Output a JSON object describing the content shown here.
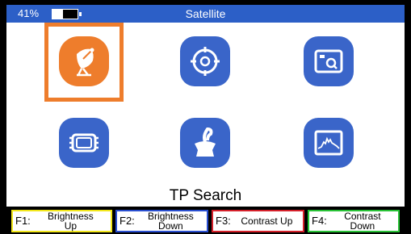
{
  "status": {
    "battery_percent_text": "41%",
    "battery_level": 0.41,
    "title": "Satellite"
  },
  "menu": {
    "items": [
      {
        "icon": "satellite-dish-icon",
        "selected": true
      },
      {
        "icon": "target-search-icon",
        "selected": false
      },
      {
        "icon": "screen-settings-icon",
        "selected": false
      },
      {
        "icon": "chip-icon",
        "selected": false
      },
      {
        "icon": "dish-antenna-icon",
        "selected": false
      },
      {
        "icon": "spectrum-icon",
        "selected": false
      }
    ],
    "selected_label": "TP Search"
  },
  "function_keys": [
    {
      "key": "F1:",
      "text": "Brightness\nUp",
      "color": "#f2e71a"
    },
    {
      "key": "F2:",
      "text": "Brightness\nDown",
      "color": "#2a4fd0"
    },
    {
      "key": "F3:",
      "text": "Contrast Up",
      "color": "#d5202a"
    },
    {
      "key": "F4:",
      "text": "Contrast\nDown",
      "color": "#28c236"
    }
  ],
  "colors": {
    "accent_blue": "#3a65c9",
    "status_blue": "#2c5fc7",
    "selection_orange": "#ee7d2c"
  }
}
